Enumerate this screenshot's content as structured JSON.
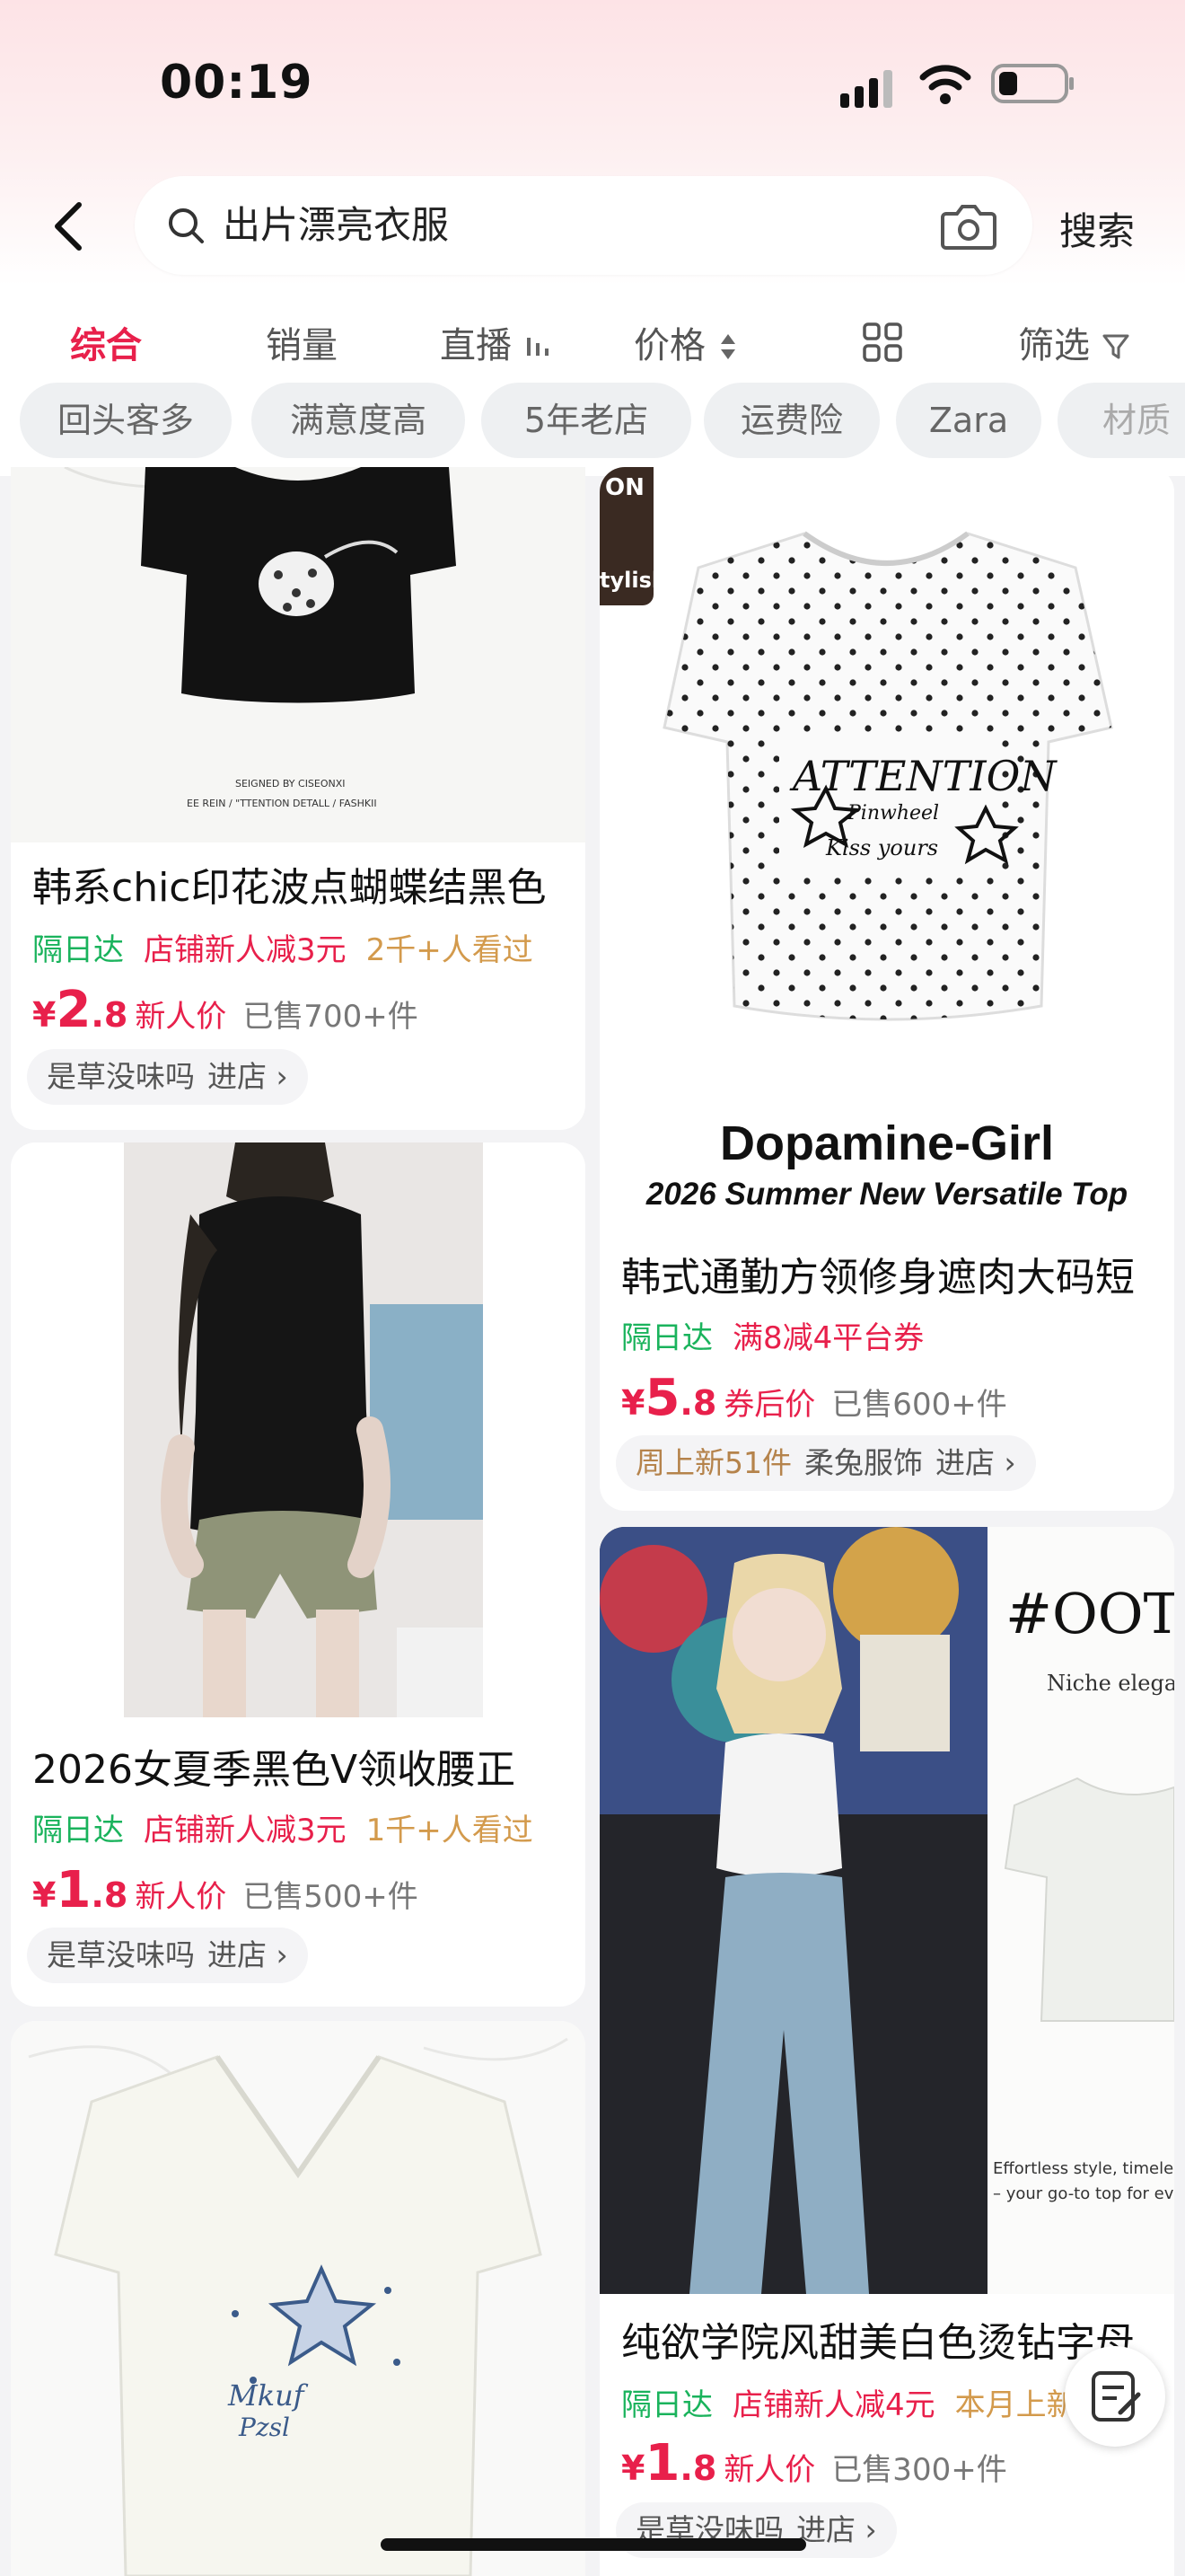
{
  "status": {
    "time": "00:19"
  },
  "search": {
    "query": "出片漂亮衣服",
    "button": "搜索"
  },
  "sort_tabs": [
    "综合",
    "销量",
    "直播",
    "价格",
    "筛选"
  ],
  "filter_chips": [
    "回头客多",
    "满意度高",
    "5年老店",
    "运费险",
    "Zara",
    "材质"
  ],
  "products": [
    {
      "image_text": [
        "SEIGNED BY CISEONXI",
        "EE REIN / \"TTENTION DETALL / FASHKII"
      ],
      "title": "韩系chic印花波点蝴蝶结黑色",
      "delivery": "隔日达",
      "promo": "店铺新人减3元",
      "views": "2千+人看过",
      "price_int": "2",
      "price_dec": ".8",
      "price_tag": "新人价",
      "sold": "已售700+件",
      "store": "是草没味吗",
      "enter": "进店 ›"
    },
    {
      "image_text": [
        "ON",
        "tylish",
        "Dopamine-Girl",
        "2026 Summer New Versatile Top"
      ],
      "title": "韩式通勤方领修身遮肉大码短",
      "delivery": "隔日达",
      "promo": "满8减4平台券",
      "price_int": "5",
      "price_dec": ".8",
      "price_tag": "券后价",
      "sold": "已售600+件",
      "store_new": "周上新51件",
      "store": "柔兔服饰",
      "enter": "进店 ›"
    },
    {
      "title": "2026女夏季黑色V领收腰正",
      "delivery": "隔日达",
      "promo": "店铺新人减3元",
      "views": "1千+人看过",
      "price_int": "1",
      "price_dec": ".8",
      "price_tag": "新人价",
      "sold": "已售500+件",
      "store": "是草没味吗",
      "enter": "进店 ›"
    },
    {
      "image_text": [
        "#OOT",
        "Niche elega",
        "Effortless style, timeles",
        "– your go-to top for eve"
      ],
      "title": "纯欲学院风甜美白色烫钻字母",
      "delivery": "隔日达",
      "promo": "店铺新人减4元",
      "views": "本月上新",
      "price_int": "1",
      "price_dec": ".8",
      "price_tag": "新人价",
      "sold": "已售300+件",
      "store": "是草没味吗",
      "enter": "进店 ›"
    },
    {
      "image_text": [
        "Mkuf",
        "Pzsl"
      ]
    }
  ],
  "colors": {
    "accent": "#e8204b",
    "green": "#1ab35c",
    "orange": "#d39a4c"
  }
}
